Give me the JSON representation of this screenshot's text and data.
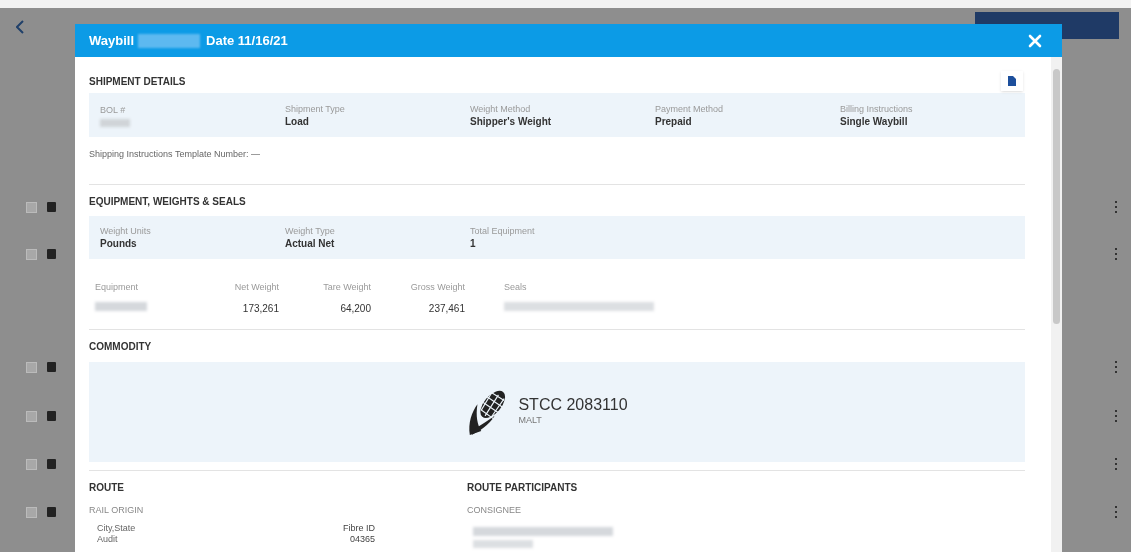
{
  "modal": {
    "title": "Waybill",
    "date": "Date 11/16/21"
  },
  "shipment_details": {
    "heading": "SHIPMENT DETAILS",
    "fields": [
      {
        "label": "BOL #"
      },
      {
        "label": "Shipment Type",
        "value": "Load"
      },
      {
        "label": "Weight Method",
        "value": "Shipper's Weight"
      },
      {
        "label": "Payment Method",
        "value": "Prepaid"
      },
      {
        "label": "Billing Instructions",
        "value": "Single Waybill"
      }
    ],
    "template_line": "Shipping Instructions Template Number: —"
  },
  "equipment": {
    "heading": "EQUIPMENT, WEIGHTS & SEALS",
    "fields": [
      {
        "label": "Weight Units",
        "value": "Pounds"
      },
      {
        "label": "Weight Type",
        "value": "Actual Net"
      },
      {
        "label": "Total Equipment",
        "value": "1"
      }
    ],
    "columns": [
      "Equipment",
      "Net Weight",
      "Tare Weight",
      "Gross Weight",
      "Seals"
    ],
    "rows": [
      {
        "net_weight": "173,261",
        "tare_weight": "64,200",
        "gross_weight": "237,461"
      }
    ]
  },
  "commodity": {
    "heading": "COMMODITY",
    "code": "STCC 2083110",
    "name": "MALT"
  },
  "route": {
    "heading": "ROUTE",
    "subheading": "RAIL ORIGIN",
    "rows": [
      {
        "label": "City,State",
        "value": "Fibre ID"
      },
      {
        "label": "Audit",
        "value": "04365"
      }
    ]
  },
  "route_participants": {
    "heading": "ROUTE PARTICIPANTS",
    "subheading": "CONSIGNEE"
  },
  "background": {
    "rows": [
      {
        "checked": false
      },
      {
        "checked": false
      },
      {
        "checked": false
      },
      {
        "checked": false
      },
      {
        "checked": false
      },
      {
        "checked": false
      }
    ]
  }
}
